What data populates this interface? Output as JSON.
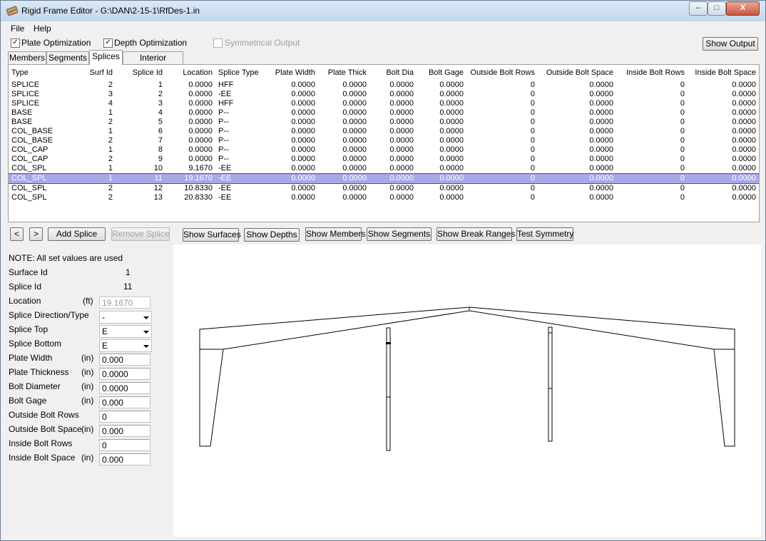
{
  "window": {
    "title": "Rigid Frame Editor - G:\\DAN\\2-15-1\\RfDes-1.in",
    "minimize_glyph": "–",
    "maximize_glyph": "□",
    "close_glyph": "X"
  },
  "menu": {
    "file": "File",
    "help": "Help"
  },
  "options": {
    "plate_optimization": {
      "label": "Plate Optimization",
      "checked": true
    },
    "depth_optimization": {
      "label": "Depth Optimization",
      "checked": true
    },
    "symmetrical_output": {
      "label": "Symmetrical Output",
      "checked": false
    },
    "show_output": "Show Output",
    "check_glyph": "✓"
  },
  "tabs": [
    {
      "label": "Members"
    },
    {
      "label": "Segments"
    },
    {
      "label": "Splices"
    },
    {
      "label": "Interior Columns"
    }
  ],
  "table": {
    "headers": [
      "Type",
      "Surf Id",
      "Splice Id",
      "Location",
      "Splice Type",
      "Plate Width",
      "Plate Thick",
      "Bolt Dia",
      "Bolt Gage",
      "Outside Bolt Rows",
      "Outside Bolt Space",
      "Inside Bolt Rows",
      "Inside Bolt Space"
    ],
    "selected_index": 10,
    "rows": [
      [
        "SPLICE",
        "2",
        "1",
        "0.0000",
        "HFF",
        "0.0000",
        "0.0000",
        "0.0000",
        "0.0000",
        "0",
        "0.0000",
        "0",
        "0.0000"
      ],
      [
        "SPLICE",
        "3",
        "2",
        "0.0000",
        "-EE",
        "0.0000",
        "0.0000",
        "0.0000",
        "0.0000",
        "0",
        "0.0000",
        "0",
        "0.0000"
      ],
      [
        "SPLICE",
        "4",
        "3",
        "0.0000",
        "HFF",
        "0.0000",
        "0.0000",
        "0.0000",
        "0.0000",
        "0",
        "0.0000",
        "0",
        "0.0000"
      ],
      [
        "BASE",
        "1",
        "4",
        "0.0000",
        "P--",
        "0.0000",
        "0.0000",
        "0.0000",
        "0.0000",
        "0",
        "0.0000",
        "0",
        "0.0000"
      ],
      [
        "BASE",
        "2",
        "5",
        "0.0000",
        "P--",
        "0.0000",
        "0.0000",
        "0.0000",
        "0.0000",
        "0",
        "0.0000",
        "0",
        "0.0000"
      ],
      [
        "COL_BASE",
        "1",
        "6",
        "0.0000",
        "P--",
        "0.0000",
        "0.0000",
        "0.0000",
        "0.0000",
        "0",
        "0.0000",
        "0",
        "0.0000"
      ],
      [
        "COL_BASE",
        "2",
        "7",
        "0.0000",
        "P--",
        "0.0000",
        "0.0000",
        "0.0000",
        "0.0000",
        "0",
        "0.0000",
        "0",
        "0.0000"
      ],
      [
        "COL_CAP",
        "1",
        "8",
        "0.0000",
        "P--",
        "0.0000",
        "0.0000",
        "0.0000",
        "0.0000",
        "0",
        "0.0000",
        "0",
        "0.0000"
      ],
      [
        "COL_CAP",
        "2",
        "9",
        "0.0000",
        "P--",
        "0.0000",
        "0.0000",
        "0.0000",
        "0.0000",
        "0",
        "0.0000",
        "0",
        "0.0000"
      ],
      [
        "COL_SPL",
        "1",
        "10",
        "9.1670",
        "-EE",
        "0.0000",
        "0.0000",
        "0.0000",
        "0.0000",
        "0",
        "0.0000",
        "0",
        "0.0000"
      ],
      [
        "COL_SPL",
        "1",
        "11",
        "19.1670",
        "-EE",
        "0.0000",
        "0.0000",
        "0.0000",
        "0.0000",
        "0",
        "0.0000",
        "0",
        "0.0000"
      ],
      [
        "COL_SPL",
        "2",
        "12",
        "10.8330",
        "-EE",
        "0.0000",
        "0.0000",
        "0.0000",
        "0.0000",
        "0",
        "0.0000",
        "0",
        "0.0000"
      ],
      [
        "COL_SPL",
        "2",
        "13",
        "20.8330",
        "-EE",
        "0.0000",
        "0.0000",
        "0.0000",
        "0.0000",
        "0",
        "0.0000",
        "0",
        "0.0000"
      ]
    ]
  },
  "toolbar": {
    "prev": "<",
    "next": ">",
    "add_splice": "Add Splice",
    "remove_splice": "Remove Splice",
    "show_surfaces": "Show Surfaces",
    "show_depths": "Show Depths",
    "show_members": "Show Members",
    "show_segments": "Show Segments",
    "show_break_ranges": "Show Break Ranges",
    "test_symmetry": "Test Symmetry"
  },
  "form": {
    "note": "NOTE: All set values are used",
    "surface_id_label": "Surface Id",
    "surface_id": "1",
    "splice_id_label": "Splice Id",
    "splice_id": "11",
    "location_label": "Location",
    "location_unit": "(ft)",
    "location": "19.1670",
    "direction_label": "Splice Direction/Type",
    "direction": "-",
    "top_label": "Splice Top",
    "top": "E",
    "bottom_label": "Splice Bottom",
    "bottom": "E",
    "plate_width_label": "Plate Width",
    "plate_width_unit": "(in)",
    "plate_width": "0.000",
    "plate_thickness_label": "Plate Thickness",
    "plate_thickness_unit": "(in)",
    "plate_thickness": "0.0000",
    "bolt_diameter_label": "Bolt Diameter",
    "bolt_diameter_unit": "(in)",
    "bolt_diameter": "0.0000",
    "bolt_gage_label": "Bolt Gage",
    "bolt_gage_unit": "(in)",
    "bolt_gage": "0.000",
    "outside_bolt_rows_label": "Outside Bolt Rows",
    "outside_bolt_rows": "0",
    "outside_bolt_space_label": "Outside Bolt Space",
    "outside_bolt_space_unit": "(in)",
    "outside_bolt_space": "0.000",
    "inside_bolt_rows_label": "Inside Bolt Rows",
    "inside_bolt_rows": "0",
    "inside_bolt_space_label": "Inside Bolt Space",
    "inside_bolt_space_unit": "(in)",
    "inside_bolt_space": "0.000"
  },
  "colors": {
    "selection": "#a8a8e8",
    "accent": "#6a7d94"
  }
}
